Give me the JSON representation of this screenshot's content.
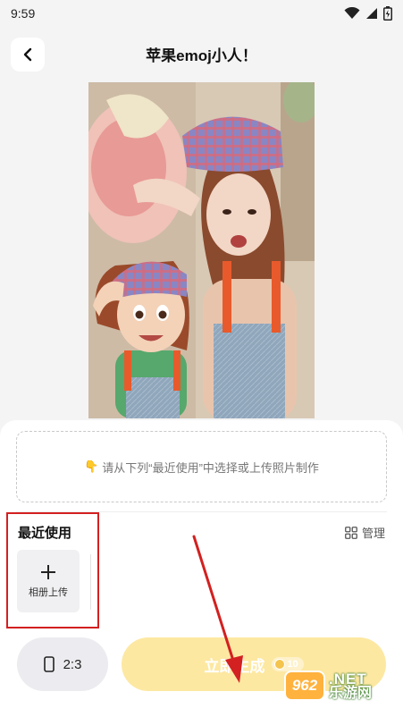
{
  "status_bar": {
    "time": "9:59",
    "icons": [
      "wifi-icon",
      "signal-icon",
      "battery-icon"
    ]
  },
  "header": {
    "title": "苹果emoj小人！",
    "back_icon": "chevron-left-icon"
  },
  "upload_box": {
    "hint_icon": "pointing-down-hand-icon",
    "hint": "请从下列“最近使用”中选择或上传照片制作"
  },
  "recent": {
    "title": "最近使用",
    "manage_label": "管理",
    "manage_icon": "grid-icon",
    "album_tile": {
      "icon": "plus-icon",
      "label": "相册上传"
    }
  },
  "actions": {
    "ratio_icon": "phone-portrait-icon",
    "ratio_label": "2:3",
    "generate_label": "立即生成",
    "cost": "10",
    "cost_icon": "coin-icon"
  },
  "watermark": {
    "logo": "962",
    "top": ".NET",
    "bottom": "乐游网"
  },
  "colors": {
    "accent_button": "#fde8a2",
    "highlight_box": "#d32020",
    "arrow": "#d32020"
  }
}
